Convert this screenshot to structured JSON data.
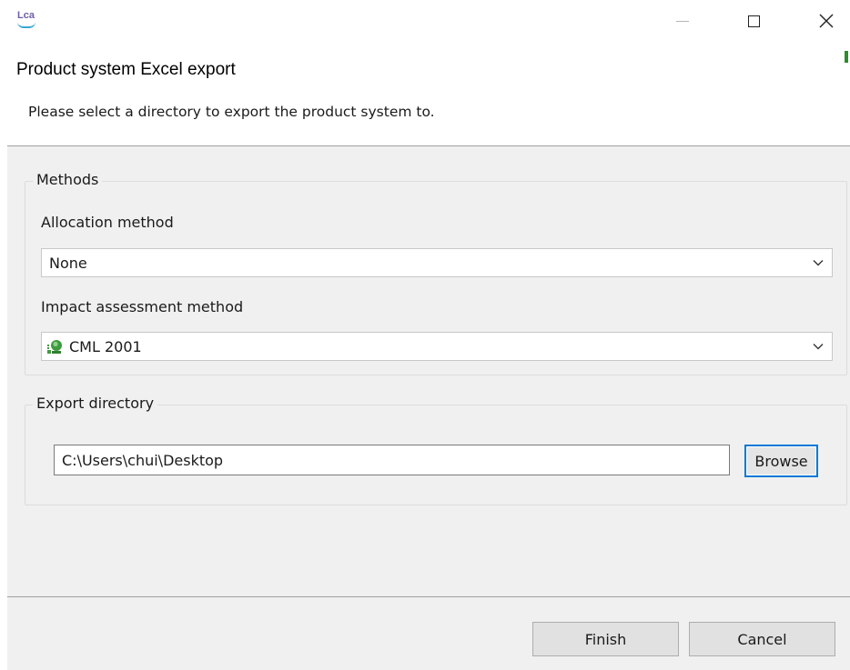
{
  "window": {
    "app_logo_text": "Lca",
    "minimize_icon": "minimize-icon",
    "maximize_icon": "maximize-icon",
    "close_icon": "close-icon"
  },
  "header": {
    "title": "Product system Excel export",
    "description": "Please select a directory to export the product system to."
  },
  "methods": {
    "group_label": "Methods",
    "allocation": {
      "label": "Allocation method",
      "selected": "None"
    },
    "impact": {
      "label": "Impact assessment method",
      "selected": "CML 2001",
      "icon": "impact-method-icon"
    }
  },
  "export": {
    "group_label": "Export directory",
    "directory_value": "C:\\Users\\chui\\Desktop",
    "browse_label": "Browse"
  },
  "footer": {
    "finish_label": "Finish",
    "cancel_label": "Cancel"
  },
  "colors": {
    "accent": "#0078d7",
    "panel_bg": "#f0f0f0",
    "logo_purple": "#6f5ca8",
    "logo_blue": "#3aa7d8",
    "icon_green": "#3f9a3f"
  }
}
